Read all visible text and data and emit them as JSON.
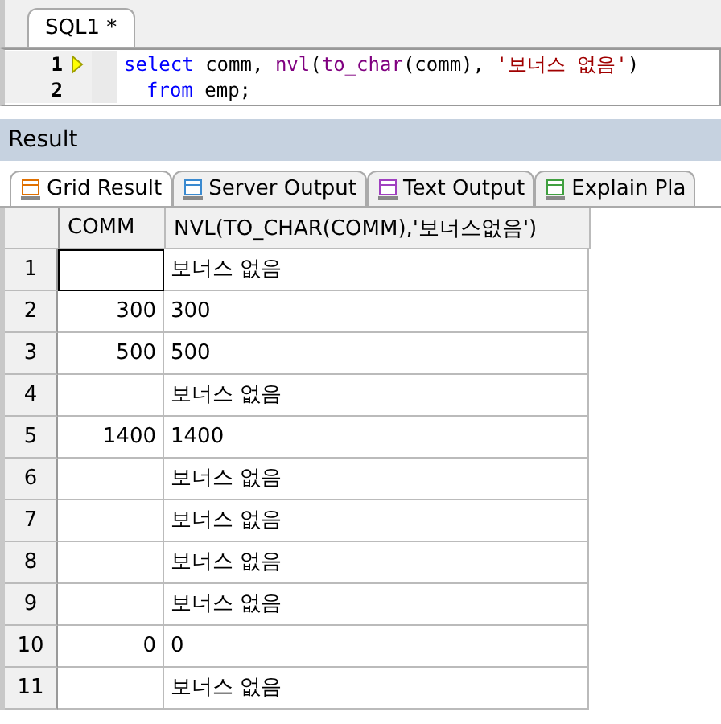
{
  "editor_tab": {
    "label": "SQL1 *",
    "selected": true
  },
  "code_lines": [
    {
      "number": "1",
      "current": true,
      "tokens": [
        {
          "kind": "keyword",
          "text": "select"
        },
        {
          "kind": "plain",
          "text": " comm, "
        },
        {
          "kind": "function",
          "text": "nvl"
        },
        {
          "kind": "plain",
          "text": "("
        },
        {
          "kind": "function",
          "text": "to_char"
        },
        {
          "kind": "plain",
          "text": "(comm), "
        },
        {
          "kind": "string",
          "text": "'보너스 없음'"
        },
        {
          "kind": "plain",
          "text": ")"
        }
      ]
    },
    {
      "number": "2",
      "current": false,
      "tokens": [
        {
          "kind": "keyword",
          "text": "from"
        },
        {
          "kind": "plain",
          "text": " emp;"
        }
      ]
    }
  ],
  "result_panel": {
    "title": "Result"
  },
  "result_tabs": [
    {
      "label": "Grid Result",
      "selected": true
    },
    {
      "label": "Server Output",
      "selected": false
    },
    {
      "label": "Text Output",
      "selected": false
    },
    {
      "label": "Explain Pla",
      "selected": false
    }
  ],
  "table": {
    "columns": [
      "COMM",
      "NVL(TO_CHAR(COMM),'보너스없음')"
    ],
    "rows": [
      {
        "number": "1",
        "selected": true,
        "cells": [
          "",
          "보너스 없음"
        ]
      },
      {
        "number": "2",
        "selected": false,
        "cells": [
          "300",
          "300"
        ]
      },
      {
        "number": "3",
        "selected": false,
        "cells": [
          "500",
          "500"
        ]
      },
      {
        "number": "4",
        "selected": false,
        "cells": [
          "",
          "보너스 없음"
        ]
      },
      {
        "number": "5",
        "selected": false,
        "cells": [
          "1400",
          "1400"
        ]
      },
      {
        "number": "6",
        "selected": false,
        "cells": [
          "",
          "보너스 없음"
        ]
      },
      {
        "number": "7",
        "selected": false,
        "cells": [
          "",
          "보너스 없음"
        ]
      },
      {
        "number": "8",
        "selected": false,
        "cells": [
          "",
          "보너스 없음"
        ]
      },
      {
        "number": "9",
        "selected": false,
        "cells": [
          "",
          "보너스 없음"
        ]
      },
      {
        "number": "10",
        "selected": false,
        "cells": [
          "0",
          "0"
        ]
      },
      {
        "number": "11",
        "selected": false,
        "cells": [
          "",
          "보너스 없음"
        ]
      }
    ]
  }
}
